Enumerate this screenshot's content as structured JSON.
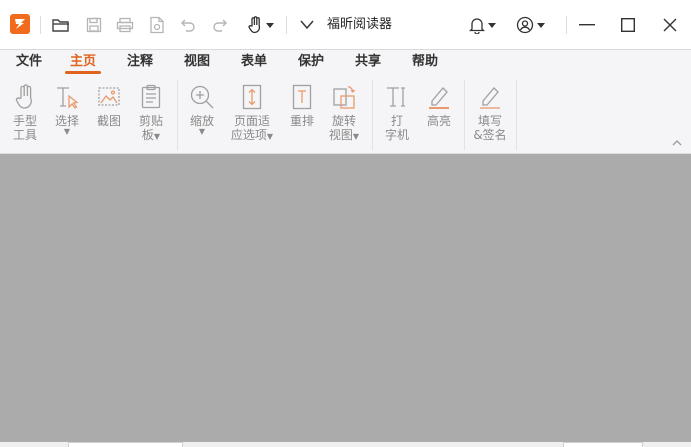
{
  "app": {
    "title": "福昕阅读器"
  },
  "colors": {
    "accent": "#e0631f",
    "doc_background": "#ababab",
    "icon_gray": "#9a9a9a"
  },
  "titlebar": {
    "icons": [
      "foxit-logo-icon",
      "open-folder-icon",
      "save-icon",
      "print-icon",
      "new-doc-icon",
      "undo-icon",
      "redo-icon",
      "hand-tool-icon",
      "customize-dropdown-icon",
      "notification-bell-icon",
      "account-icon",
      "minimize-icon",
      "maximize-icon",
      "close-icon"
    ]
  },
  "menu": {
    "items": [
      "文件",
      "主页",
      "注释",
      "视图",
      "表单",
      "保护",
      "共享",
      "帮助"
    ],
    "active": "主页"
  },
  "ribbon": {
    "hand_tool": {
      "line1": "手型",
      "line2": "工具"
    },
    "select": {
      "line1": "选择"
    },
    "snapshot": {
      "line1": "截图"
    },
    "clipboard": {
      "line1": "剪贴",
      "line2": "板"
    },
    "zoom": {
      "line1": "缩放"
    },
    "page_fit": {
      "line1": "页面适",
      "line2": "应选项"
    },
    "reflow": {
      "line1": "重排"
    },
    "rotate": {
      "line1": "旋转",
      "line2": "视图"
    },
    "typewriter": {
      "line1": "打",
      "line2": "字机"
    },
    "highlight": {
      "line1": "高亮"
    },
    "fill_sign": {
      "line1": "填写",
      "line2": "&签名"
    }
  }
}
